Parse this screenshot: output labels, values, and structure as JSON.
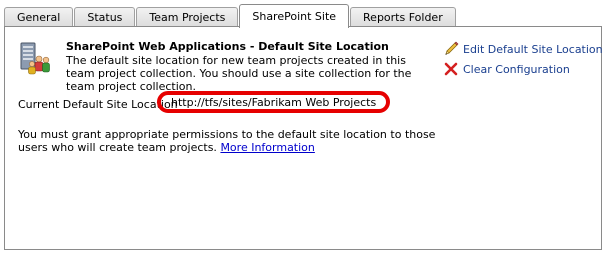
{
  "tabs": [
    {
      "label": "General",
      "active": false
    },
    {
      "label": "Status",
      "active": false
    },
    {
      "label": "Team Projects",
      "active": false
    },
    {
      "label": "SharePoint Site",
      "active": true
    },
    {
      "label": "Reports Folder",
      "active": false
    }
  ],
  "header": {
    "icon": "sharepoint-server-users-icon",
    "title": "SharePoint Web Applications - Default Site Location",
    "description": "The default site location for new team projects created in this team project collection. You should use a site collection for the team project collection."
  },
  "actions": {
    "edit": {
      "label": "Edit Default Site Location",
      "icon": "pencil-icon"
    },
    "clear": {
      "label": "Clear Configuration",
      "icon": "red-x-icon"
    }
  },
  "location": {
    "label": "Current Default Site Location",
    "value": "http://tfs/sites/Fabrikam Web Projects",
    "highlight_color": "#e60000"
  },
  "note": {
    "text": "You must grant appropriate permissions to the default site location to those users who will create team projects.",
    "link": "More Information"
  }
}
